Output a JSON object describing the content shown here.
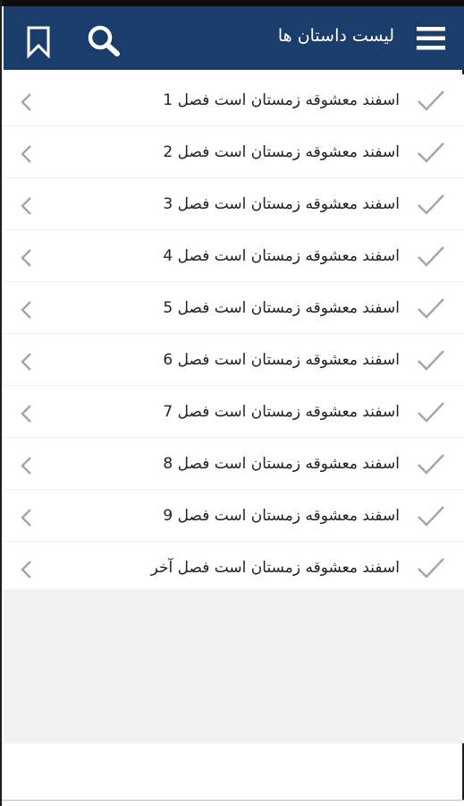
{
  "app": {
    "title": "لیست داستان ها",
    "colors": {
      "appbar": "#1b3d6b",
      "icon_gray": "#9e9e9e"
    },
    "icons": {
      "menu": "hamburger-menu",
      "search": "magnifier",
      "bookmark": "bookmark-outline"
    }
  },
  "chapters": [
    {
      "label": "اسفند معشوقه زمستان است فصل 1",
      "read": true
    },
    {
      "label": "اسفند معشوقه زمستان است فصل 2",
      "read": true
    },
    {
      "label": "اسفند معشوقه زمستان است فصل 3",
      "read": true
    },
    {
      "label": "اسفند معشوقه زمستان است فصل 4",
      "read": true
    },
    {
      "label": "اسفند معشوقه زمستان است فصل 5",
      "read": true
    },
    {
      "label": "اسفند معشوقه زمستان است فصل 6",
      "read": true
    },
    {
      "label": "اسفند معشوقه زمستان است فصل 7",
      "read": true
    },
    {
      "label": "اسفند معشوقه زمستان است فصل 8",
      "read": true
    },
    {
      "label": "اسفند معشوقه زمستان است فصل 9",
      "read": true
    },
    {
      "label": "اسفند معشوقه زمستان است فصل آخر",
      "read": true
    }
  ]
}
